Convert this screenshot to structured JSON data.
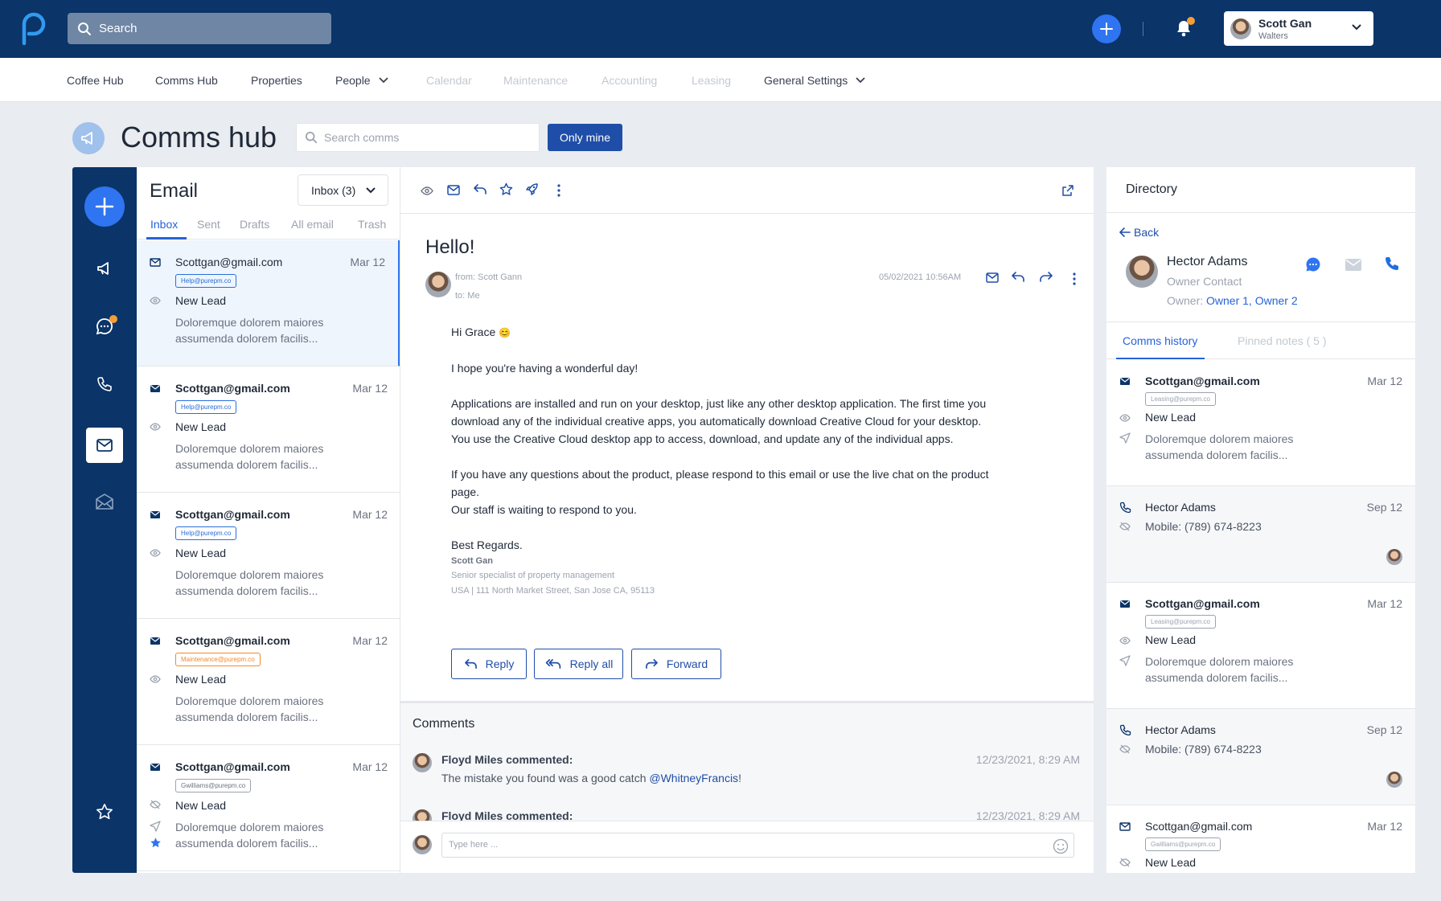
{
  "topbar": {
    "search_label": "Search",
    "notification_count": "",
    "user": {
      "name": "Scott Gan",
      "subtitle": "Walters"
    }
  },
  "nav": {
    "items": [
      {
        "label": "Coffee Hub",
        "state": "enabled"
      },
      {
        "label": "Comms Hub",
        "state": "enabled"
      },
      {
        "label": "Properties",
        "state": "enabled"
      },
      {
        "label": "People",
        "state": "enabled",
        "dropdown": true
      },
      {
        "label": "Calendar",
        "state": "disabled"
      },
      {
        "label": "Maintenance",
        "state": "disabled"
      },
      {
        "label": "Accounting",
        "state": "disabled"
      },
      {
        "label": "Leasing",
        "state": "disabled"
      },
      {
        "label": "General Settings",
        "state": "enabled",
        "dropdown": true
      }
    ]
  },
  "page": {
    "title": "Comms hub",
    "search_placeholder": "Search comms",
    "only_mine_label": "Only mine"
  },
  "rail": {
    "icons": [
      "plus-icon",
      "megaphone-icon",
      "chat-icon",
      "phone-icon",
      "mail-icon",
      "mail-open-icon",
      "star-icon"
    ],
    "active": "mail-icon"
  },
  "email_list": {
    "title": "Email",
    "folder_select": "Inbox (3)",
    "tabs": [
      "Inbox",
      "Sent",
      "Drafts",
      "All email",
      "Trash"
    ],
    "active_tab": "Inbox",
    "items": [
      {
        "from": "Scottgan@gmail.com",
        "date": "Mar 12",
        "tag": "Help@purepm.co",
        "tag_style": "help",
        "subject": "New Lead",
        "preview": "Doloremque dolorem maiores assumenda dolorem facilis...",
        "read": true,
        "selected": true
      },
      {
        "from": "Scottgan@gmail.com",
        "date": "Mar 12",
        "tag": "Help@purepm.co",
        "tag_style": "help",
        "subject": "New Lead",
        "preview": "Doloremque dolorem maiores assumenda dolorem facilis...",
        "read": false
      },
      {
        "from": "Scottgan@gmail.com",
        "date": "Mar 12",
        "tag": "Help@purepm.co",
        "tag_style": "help",
        "subject": "New Lead",
        "preview": "Doloremque dolorem maiores assumenda dolorem facilis...",
        "read": false
      },
      {
        "from": "Scottgan@gmail.com",
        "date": "Mar 12",
        "tag": "Maintenance@purepm.co",
        "tag_style": "maint",
        "subject": "New Lead",
        "preview": "Doloremque dolorem maiores assumenda dolorem facilis...",
        "read": false
      },
      {
        "from": "Scottgan@gmail.com",
        "date": "Mar 12",
        "tag": "Gwilliams@purepm.co",
        "tag_style": "gray",
        "subject": "New Lead",
        "preview": "Doloremque dolorem maiores assumenda dolorem facilis...",
        "read": false,
        "starred": true
      }
    ]
  },
  "message": {
    "subject": "Hello!",
    "from": "from: Scott Gann",
    "to": "to: Me",
    "timestamp": "05/02/2021 10:56AM",
    "greeting": "Hi Grace",
    "greeting_emoji": "😊",
    "paragraphs": [
      "I hope you're having a wonderful day!",
      "Applications are installed and run on your desktop, just like any other desktop application. The first time you download any of the individual creative apps, you automatically download Creative Cloud for your desktop. You use the Creative Cloud desktop app to access, download, and update any of the individual apps.",
      "If you have any questions about the product, please respond to this email or use the live chat on the product page.\nOur staff is waiting to respond to you."
    ],
    "closing": "Best Regards.",
    "signature": {
      "name": "Scott Gan",
      "title": "Senior specialist of property management",
      "address": "USA | 111 North Market Street, San Jose CA, 95113"
    },
    "buttons": {
      "reply": "Reply",
      "reply_all": "Reply all",
      "forward": "Forward"
    }
  },
  "comments": {
    "title": "Comments",
    "items": [
      {
        "author": "Floyd Miles commented:",
        "time": "12/23/2021, 8:29 AM",
        "text": "The mistake you found was a good catch ",
        "mention": "@WhitneyFrancis",
        "suffix": "!"
      },
      {
        "author": "Floyd Miles commented:",
        "time": "12/23/2021, 8:29 AM",
        "text": "",
        "mention": "",
        "suffix": ""
      }
    ],
    "input_placeholder": "Type here ..."
  },
  "directory": {
    "title": "Directory",
    "back_label": "Back",
    "contact": {
      "name": "Hector Adams",
      "role": "Owner Contact",
      "owner_label": "Owner: ",
      "owner_links": "Owner 1, Owner 2"
    },
    "tabs": [
      "Comms history",
      "Pinned notes ( 5 )"
    ],
    "active_tab": "Comms history",
    "history": [
      {
        "type": "email",
        "title": "Scottgan@gmail.com",
        "date": "Mar 12",
        "tag": "Leasing@purepm.co",
        "subject": "New Lead",
        "preview": "Doloremque dolorem maiores assumenda dolorem facilis...",
        "bold": true
      },
      {
        "type": "call",
        "title": "Hector Adams",
        "date": "Sep 12",
        "line2": "Mobile: (789) 674-8223"
      },
      {
        "type": "email",
        "title": "Scottgan@gmail.com",
        "date": "Mar 12",
        "tag": "Leasing@purepm.co",
        "subject": "New Lead",
        "preview": "Doloremque dolorem maiores assumenda dolorem facilis...",
        "bold": true
      },
      {
        "type": "call",
        "title": "Hector Adams",
        "date": "Sep 12",
        "line2": "Mobile: (789) 674-8223"
      },
      {
        "type": "email",
        "title": "Scottgan@gmail.com",
        "date": "Mar 12",
        "tag": "Gwilliams@purepm.co",
        "subject": "New Lead",
        "preview": "",
        "bold": false
      }
    ]
  },
  "colors": {
    "topbar": "#0b3468",
    "accent": "#2f74f0",
    "primary_button": "#1f4ea8",
    "badge": "#f59e36",
    "maintenance_tag": "#f08a2d"
  }
}
